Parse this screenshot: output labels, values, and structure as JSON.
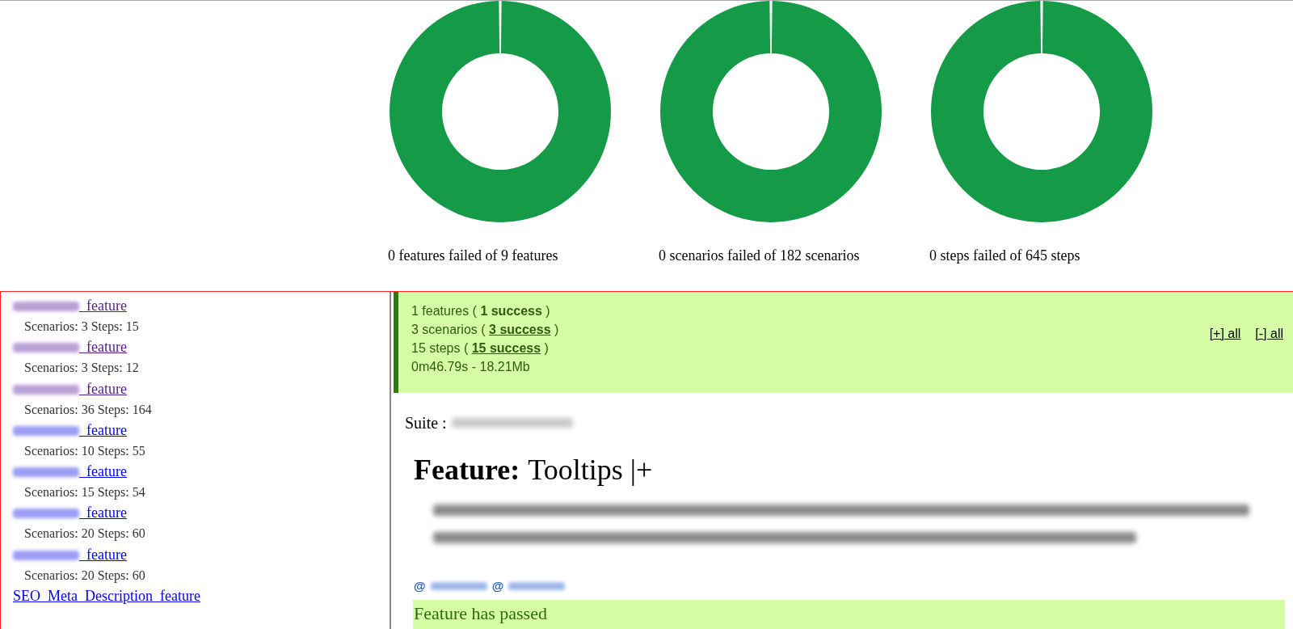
{
  "summary_charts": [
    {
      "caption": "0 features failed of 9 features",
      "level": 1
    },
    {
      "caption": "0 scenarios failed of 182 scenarios",
      "level": 1
    },
    {
      "caption": "0 steps failed of 645 steps",
      "level": 1
    }
  ],
  "feature_list": [
    {
      "link": "_feature",
      "visited": true,
      "redacted_prefix": true,
      "counts": "Scenarios: 3 Steps: 15"
    },
    {
      "link": "_feature",
      "visited": true,
      "redacted_prefix": true,
      "counts": "Scenarios: 3 Steps: 12"
    },
    {
      "link": "_feature",
      "visited": true,
      "redacted_prefix": true,
      "counts": "Scenarios: 36 Steps: 164"
    },
    {
      "link": "_feature",
      "visited": false,
      "redacted_prefix": true,
      "counts": "Scenarios: 10 Steps: 55"
    },
    {
      "link": "_feature",
      "visited": false,
      "redacted_prefix": true,
      "counts": "Scenarios: 15 Steps: 54"
    },
    {
      "link": "_feature",
      "visited": false,
      "redacted_prefix": true,
      "counts": "Scenarios: 20 Steps: 60"
    },
    {
      "link": "_feature",
      "visited": false,
      "redacted_prefix": true,
      "counts": "Scenarios: 20 Steps: 60"
    },
    {
      "link": "SEO_Meta_Description_feature",
      "visited": false,
      "redacted_prefix": false
    }
  ],
  "summary": {
    "lines": [
      {
        "text": "1 features ( ",
        "success": "1 success",
        "linked": false,
        "end": " )"
      },
      {
        "text": "3 scenarios ( ",
        "success": "3 success",
        "linked": true,
        "end": " )"
      },
      {
        "text": "15 steps ( ",
        "success": "15 success",
        "linked": true,
        "end": " )"
      },
      {
        "text": "0m46.79s - 18.21Mb"
      }
    ],
    "controls": [
      "[+] all",
      "[-] all"
    ]
  },
  "suite_label": "Suite :",
  "feature": {
    "keyword": "Feature:",
    "name": "Tooltips |+",
    "tags": [
      "@",
      "@"
    ],
    "status": "Feature has passed"
  }
}
